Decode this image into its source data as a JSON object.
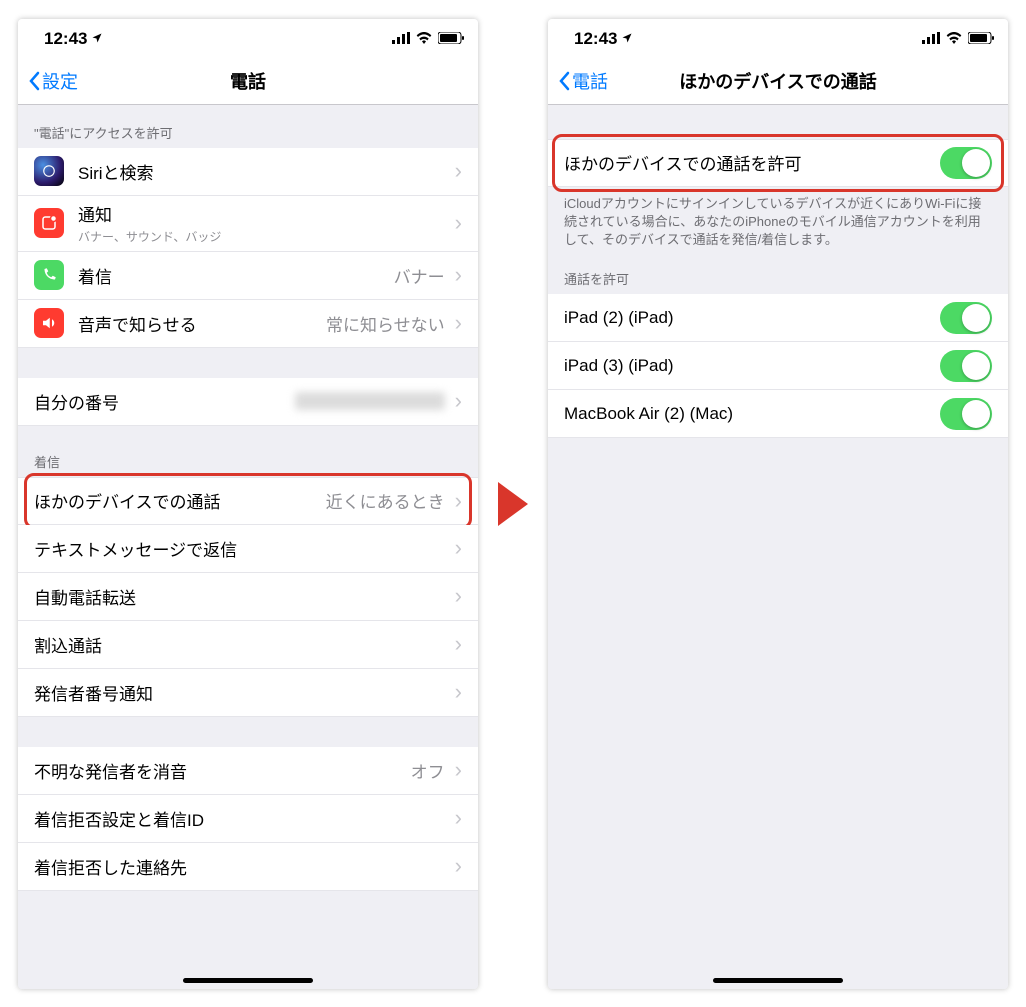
{
  "status": {
    "time": "12:43"
  },
  "screen1": {
    "back": "設定",
    "title": "電話",
    "section_access": "\"電話\"にアクセスを許可",
    "siri": "Siriと検索",
    "notif": "通知",
    "notif_sub": "バナー、サウンド、バッジ",
    "incoming": "着信",
    "incoming_val": "バナー",
    "voice": "音声で知らせる",
    "voice_val": "常に知らせない",
    "mynumber": "自分の番号",
    "section_incoming": "着信",
    "other_devices": "ほかのデバイスでの通話",
    "other_devices_val": "近くにあるとき",
    "text_reply": "テキストメッセージで返信",
    "call_forward": "自動電話転送",
    "call_waiting": "割込通話",
    "caller_id_notify": "発信者番号通知",
    "silence_unknown": "不明な発信者を消音",
    "silence_unknown_val": "オフ",
    "block_settings": "着信拒否設定と着信ID",
    "blocked_contacts": "着信拒否した連絡先"
  },
  "screen2": {
    "back": "電話",
    "title": "ほかのデバイスでの通話",
    "allow": "ほかのデバイスでの通話を許可",
    "footer": "iCloudアカウントにサインインしているデバイスが近くにありWi-Fiに接続されている場合に、あなたのiPhoneのモバイル通信アカウントを利用して、そのデバイスで通話を発信/着信します。",
    "section_allow": "通話を許可",
    "device1": "iPad (2) (iPad)",
    "device2": "iPad (3) (iPad)",
    "device3": "MacBook Air (2) (Mac)"
  }
}
